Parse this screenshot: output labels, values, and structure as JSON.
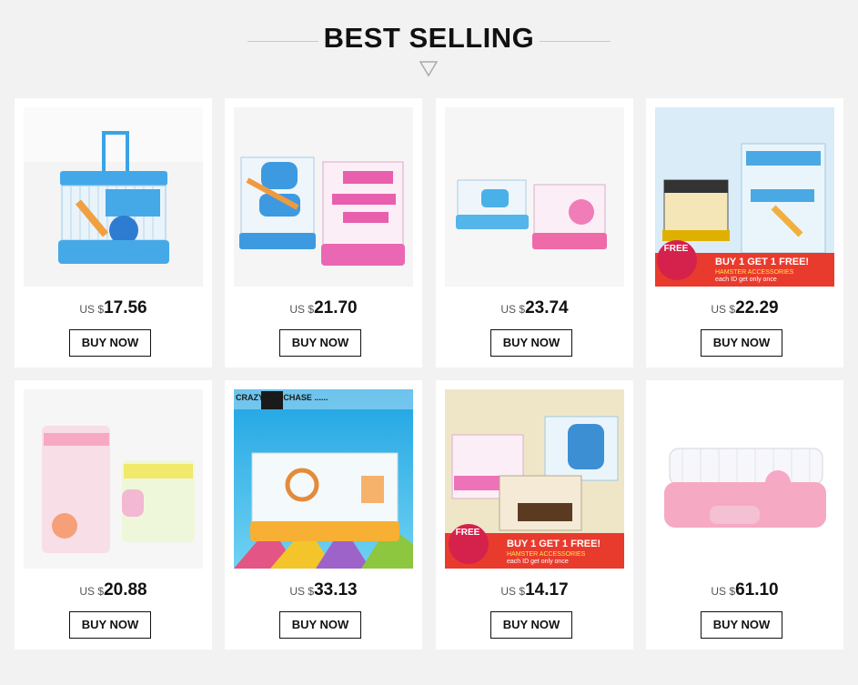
{
  "header": {
    "title": "BEST SELLING"
  },
  "currency_prefix": "US $",
  "products": [
    {
      "price": "17.56",
      "buy_label": "BUY NOW"
    },
    {
      "price": "21.70",
      "buy_label": "BUY NOW"
    },
    {
      "price": "23.74",
      "buy_label": "BUY NOW"
    },
    {
      "price": "22.29",
      "buy_label": "BUY NOW",
      "promo": {
        "headline": "BUY 1 GET 1 FREE!",
        "line1": "HAMSTER ACCESSORIES",
        "line2": "each ID get only once",
        "badge": "FREE"
      }
    },
    {
      "price": "20.88",
      "buy_label": "BUY NOW"
    },
    {
      "price": "33.13",
      "buy_label": "BUY NOW",
      "banner": "CRAZY PURCHASE ......"
    },
    {
      "price": "14.17",
      "buy_label": "BUY NOW",
      "promo": {
        "headline": "BUY 1 GET 1 FREE!",
        "line1": "HAMSTER ACCESSORIES",
        "line2": "each ID get only once",
        "badge": "FREE"
      }
    },
    {
      "price": "61.10",
      "buy_label": "BUY NOW"
    }
  ]
}
